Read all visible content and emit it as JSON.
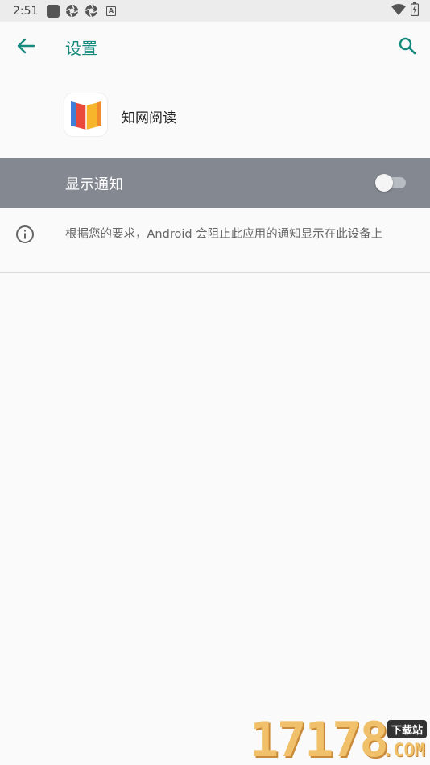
{
  "status_bar": {
    "time": "2:51",
    "icons": [
      "square-notification-icon",
      "aperture-icon",
      "aperture-icon",
      "a-letter-icon",
      "wifi-icon",
      "battery-icon"
    ]
  },
  "app_bar": {
    "title": "设置",
    "back_icon": "arrow-back-icon",
    "search_icon": "search-icon",
    "accent_color": "#168a7d"
  },
  "app_header": {
    "app_name": "知网阅读",
    "icon": "book-icon"
  },
  "notification_toggle": {
    "label": "显示通知",
    "checked": false,
    "row_color": "#838891"
  },
  "info": {
    "icon": "info-icon",
    "text": "根据您的要求，Android 会阻止此应用的通知显示在此设备上"
  },
  "watermark": {
    "digits": "17178",
    "tag": "下载站",
    "domain": ".COM"
  }
}
